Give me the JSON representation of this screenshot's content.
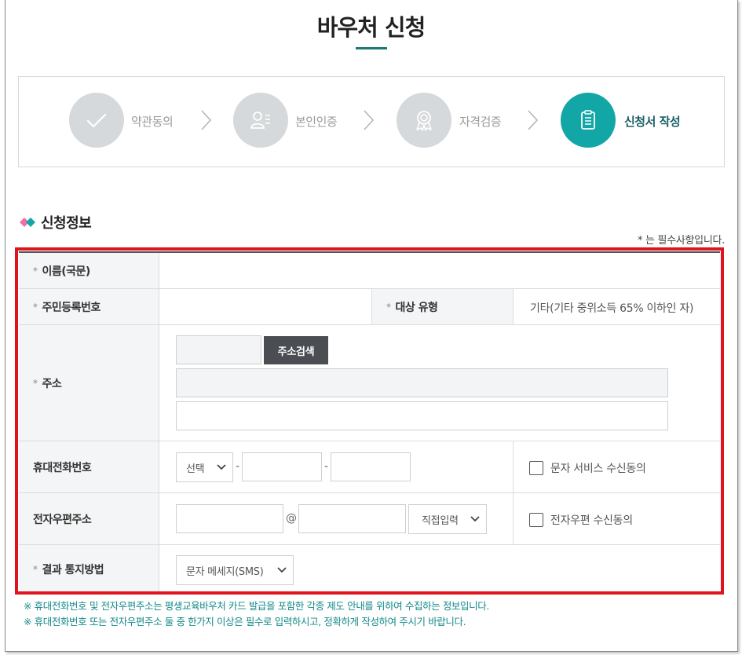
{
  "page": {
    "title": "바우처 신청"
  },
  "steps": [
    {
      "label": "약관동의",
      "icon": "check-icon",
      "active": false
    },
    {
      "label": "본인인증",
      "icon": "person-list-icon",
      "active": false
    },
    {
      "label": "자격검증",
      "icon": "award-icon",
      "active": false
    },
    {
      "label": "신청서 작성",
      "icon": "clipboard-icon",
      "active": true
    }
  ],
  "section": {
    "title": "신청정보",
    "required_note": "* 는 필수사항입니다."
  },
  "form": {
    "name_label": "이름(국문)",
    "rrn_label": "주민등록번호",
    "target_label": "대상 유형",
    "target_value": "기타(기타 중위소득 65% 이하인 자)",
    "address_label": "주소",
    "address_search_button": "주소검색",
    "phone_label": "휴대전화번호",
    "phone_select_value": "선택",
    "sms_consent_label": "문자 서비스 수신동의",
    "email_label": "전자우편주소",
    "email_at": "@",
    "email_domain_select_value": "직접입력",
    "email_consent_label": "전자우편 수신동의",
    "notify_label": "결과 통지방법",
    "notify_select_value": "문자 메세지(SMS)"
  },
  "notes": [
    "※ 휴대전화번호 및 전자우편주소는 평생교육바우처 카드 발급을 포함한 각종 제도 안내를 위하여 수집하는 정보입니다.",
    "※ 휴대전화번호 또는 전자우편주소 둘 중 한가지 이상은 필수로 입력하시고, 정확하게 작성하여 주시기 바랍니다."
  ],
  "colors": {
    "accent": "#13a6a6",
    "highlight_border": "#e0141f",
    "note_text": "#138a88"
  }
}
